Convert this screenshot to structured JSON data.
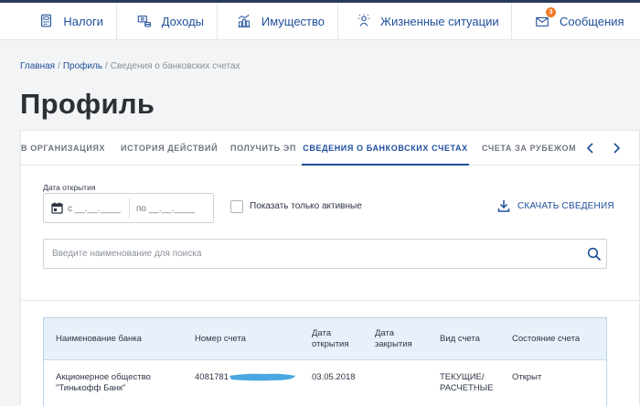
{
  "nav": {
    "items": [
      {
        "label": "Налоги",
        "icon": "calculator-doc-icon"
      },
      {
        "label": "Доходы",
        "icon": "money-stack-icon"
      },
      {
        "label": "Имущество",
        "icon": "property-chart-icon"
      },
      {
        "label": "Жизненные ситуации",
        "icon": "life-situations-icon"
      },
      {
        "label": "Сообщения",
        "icon": "messages-icon",
        "badge": "3"
      }
    ]
  },
  "breadcrumb": {
    "home": "Главная",
    "profile": "Профиль",
    "current": "Сведения о банковских счетах"
  },
  "page_title": "Профиль",
  "tabs": [
    {
      "label": "в организациях"
    },
    {
      "label": "История действий"
    },
    {
      "label": "Получить ЭП"
    },
    {
      "label": "Сведения о банковских счетах",
      "active": true
    },
    {
      "label": "Счета за рубежом"
    }
  ],
  "filters": {
    "date_label": "Дата открытия",
    "date_from": "с __.__.____",
    "date_to": "по __.__.____",
    "active_only_label": "Показать только активные",
    "active_only_checked": false,
    "download_label": "СКАЧАТЬ СВЕДЕНИЯ",
    "search_placeholder": "Введите наименование для поиска"
  },
  "table": {
    "headers": {
      "bank": "Наименование банка",
      "account": "Номер счета",
      "opened_1": "Дата",
      "opened_2": "открытия",
      "closed_1": "Дата",
      "closed_2": "закрытия",
      "type": "Вид счета",
      "status": "Состояние счета"
    },
    "rows": [
      {
        "bank_1": "Акционерное общество",
        "bank_2": "\"Тинькофф Банк\"",
        "account": "4081781",
        "opened": "03.05.2018",
        "closed": "",
        "type_1": "ТЕКУЩИЕ/",
        "type_2": "РАСЧЕТНЫЕ",
        "status": "Открыт"
      }
    ]
  },
  "colors": {
    "accent": "#1e4e9c",
    "badge": "#f07a2a",
    "header_bg": "#e8f1fa",
    "redaction": "#4aa8e0"
  }
}
